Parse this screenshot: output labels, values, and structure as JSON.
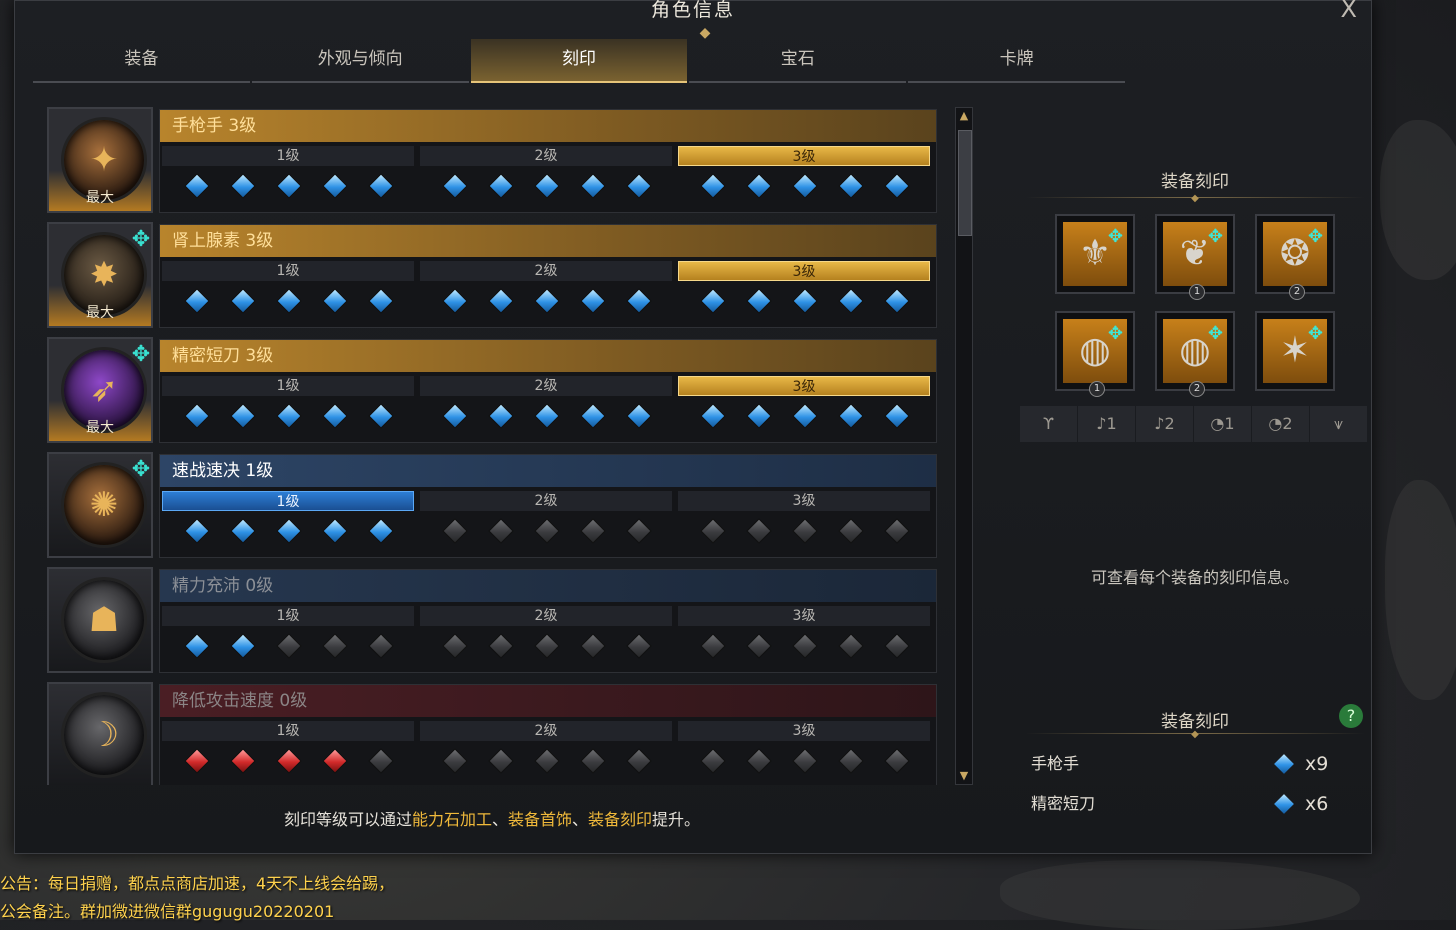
{
  "window": {
    "title": "角色信息",
    "close_label": "X"
  },
  "tabs": [
    "装备",
    "外观与倾向",
    "刻印",
    "宝石",
    "卡牌"
  ],
  "active_tab": 2,
  "level_labels": [
    "1级",
    "2级",
    "3级"
  ],
  "max_label": "最大",
  "engravings": [
    {
      "name": "手枪手 3级",
      "level": 3,
      "max": true,
      "stat": false,
      "style": "gold",
      "gems": [
        "blue",
        "blue",
        "blue",
        "blue",
        "blue",
        "blue",
        "blue",
        "blue",
        "blue",
        "blue",
        "blue",
        "blue",
        "blue",
        "blue",
        "blue"
      ],
      "glyph": "✦",
      "orb": "orange"
    },
    {
      "name": "肾上腺素 3级",
      "level": 3,
      "max": true,
      "stat": true,
      "style": "gold",
      "gems": [
        "blue",
        "blue",
        "blue",
        "blue",
        "blue",
        "blue",
        "blue",
        "blue",
        "blue",
        "blue",
        "blue",
        "blue",
        "blue",
        "blue",
        "blue"
      ],
      "glyph": "✸",
      "orb": ""
    },
    {
      "name": "精密短刀 3级",
      "level": 3,
      "max": true,
      "stat": true,
      "style": "gold",
      "gems": [
        "blue",
        "blue",
        "blue",
        "blue",
        "blue",
        "blue",
        "blue",
        "blue",
        "blue",
        "blue",
        "blue",
        "blue",
        "blue",
        "blue",
        "blue"
      ],
      "glyph": "➶",
      "orb": "purple"
    },
    {
      "name": "速战速决 1级",
      "level": 1,
      "max": false,
      "stat": true,
      "style": "blue",
      "gems": [
        "blue",
        "blue",
        "blue",
        "blue",
        "blue",
        "gray",
        "gray",
        "gray",
        "gray",
        "gray",
        "gray",
        "gray",
        "gray",
        "gray",
        "gray"
      ],
      "glyph": "✺",
      "orb": "orange"
    },
    {
      "name": "精力充沛 0级",
      "level": 0,
      "max": false,
      "stat": false,
      "style": "dim-blue",
      "gems": [
        "blue",
        "blue",
        "gray",
        "gray",
        "gray",
        "gray",
        "gray",
        "gray",
        "gray",
        "gray",
        "gray",
        "gray",
        "gray",
        "gray",
        "gray"
      ],
      "glyph": "☗",
      "orb": "gray"
    },
    {
      "name": "降低攻击速度 0级",
      "level": 0,
      "max": false,
      "stat": false,
      "style": "dim-red",
      "gems": [
        "red",
        "red",
        "red",
        "red",
        "gray",
        "gray",
        "gray",
        "gray",
        "gray",
        "gray",
        "gray",
        "gray",
        "gray",
        "gray",
        "gray"
      ],
      "glyph": "☽",
      "orb": "gray"
    }
  ],
  "right_panel": {
    "equip_title": "装备刻印",
    "slots": [
      {
        "glyph": "⚜",
        "num": ""
      },
      {
        "glyph": "❦",
        "num": "1"
      },
      {
        "glyph": "❂",
        "num": "2"
      },
      {
        "glyph": "◍",
        "num": "1"
      },
      {
        "glyph": "◍",
        "num": "2"
      },
      {
        "glyph": "✶",
        "num": ""
      }
    ],
    "filters": [
      "ϒ",
      "♪1",
      "♪2",
      "◔1",
      "◔2",
      "⩛"
    ],
    "info": "可查看每个装备的刻印信息。",
    "summary_title": "装备刻印",
    "help_label": "?",
    "summary": [
      {
        "name": "手枪手",
        "count": "x9"
      },
      {
        "name": "精密短刀",
        "count": "x6"
      }
    ]
  },
  "footer": {
    "parts": [
      "刻印等级可以通过",
      "能力石加工",
      "、",
      "装备首饰",
      "、",
      "装备刻印",
      "提升。"
    ]
  },
  "notices": [
    "公告：每日捐赠，都点点商店加速，4天不上线会给踢，",
    "公会备注。群加微进微信群gugugu20220201"
  ],
  "colors": {
    "gold": "#e6c479",
    "teal": "#39e0d0",
    "highlight": "#f0b93a"
  }
}
